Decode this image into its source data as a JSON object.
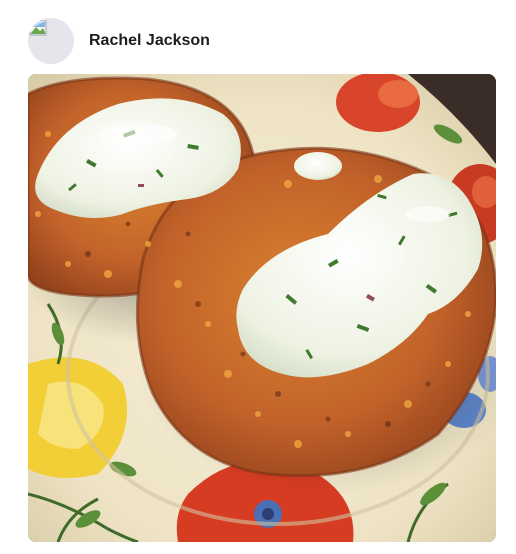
{
  "post": {
    "author_name": "Rachel Jackson",
    "avatar_icon": "broken-image-icon",
    "photo_subject": "corn-fritters-with-yogurt-sauce-photo"
  },
  "colors": {
    "author_text": "#1c1e21",
    "avatar_bg": "#e4e6eb",
    "fritter": "#c46a2c",
    "sauce": "#eef2e4",
    "plate": "#f3ecd6",
    "flower_red": "#d63c22",
    "flower_yellow": "#f0cf3a"
  }
}
